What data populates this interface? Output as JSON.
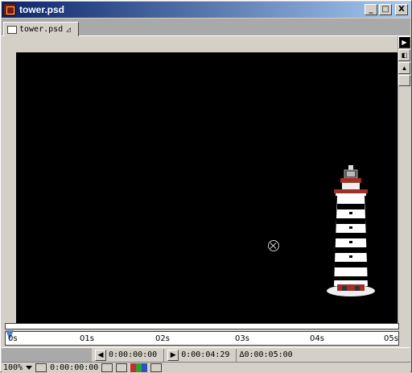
{
  "window": {
    "title": "tower.psd",
    "controls": {
      "minimize": "_",
      "maximize": "□",
      "close": "X"
    }
  },
  "tab": {
    "label": "tower.psd",
    "close_glyph": "◿"
  },
  "timeline": {
    "ticks": [
      "0s",
      "01s",
      "02s",
      "03s",
      "04s",
      "05s"
    ]
  },
  "time_controls": {
    "start_time": "0:00:00:00",
    "end_time": "0:00:04:29",
    "duration": "Δ0:00:05:00"
  },
  "statusbar": {
    "zoom": "100%",
    "current_time": "0:00:00:00"
  },
  "colors": {
    "title_start": "#0a246a",
    "title_end": "#a6caf0",
    "canvas_bg": "#000000"
  }
}
